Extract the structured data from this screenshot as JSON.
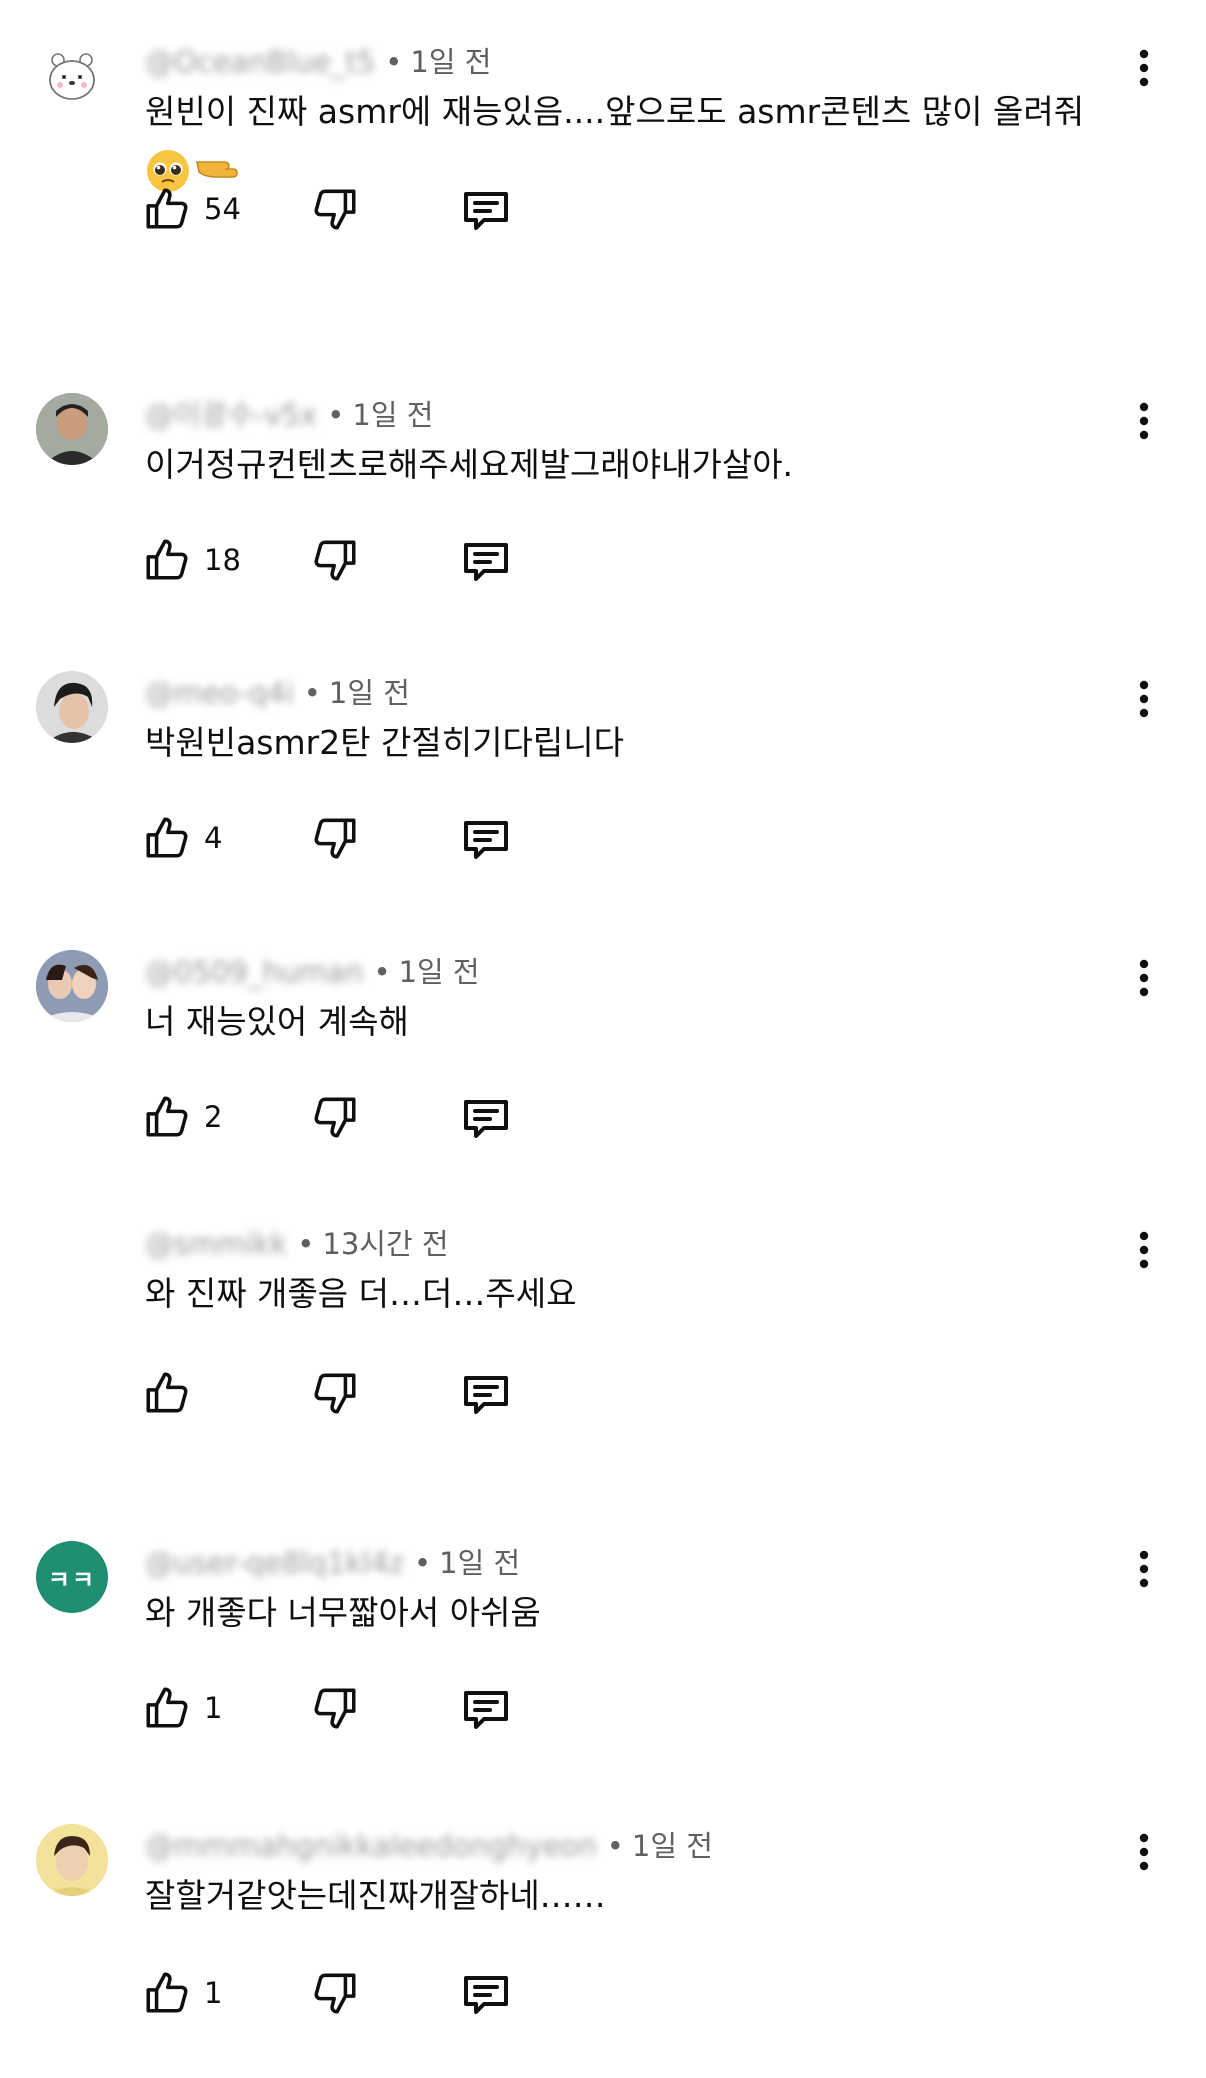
{
  "comments": [
    {
      "handle": "@OceanBlue_t5",
      "time": "1일 전",
      "text": "원빈이 진짜 asmr에 재능있음....앞으로도 asmr콘텐츠 많이 올려줘",
      "emoji": "🥺 👉",
      "likes": "54",
      "avatar": "bear-avatar"
    },
    {
      "handle": "@이광수-v5x",
      "time": "1일 전",
      "text": "이거정규컨텐츠로해주세요제발그래야내가살아.",
      "likes": "18",
      "avatar": "photo-avatar"
    },
    {
      "handle": "@meo-q4i",
      "time": "1일 전",
      "text": "박원빈asmr2탄 간절히기다립니다",
      "likes": "4",
      "avatar": "photo-avatar"
    },
    {
      "handle": "@0509_human",
      "time": "1일 전",
      "text": "너 재능있어 계속해",
      "likes": "2",
      "avatar": "photo-avatar"
    },
    {
      "handle": "@smmikk",
      "time": "13시간 전",
      "text": "와 진짜 개좋음 더…더…주세요",
      "likes": "",
      "avatar": "none"
    },
    {
      "handle": "@user-qe8lq1kl4z",
      "time": "1일 전",
      "text": "와 개좋다 너무짧아서 아쉬움",
      "likes": "1",
      "avatar": "letter-avatar",
      "avatar_text": "ㅋㅋ",
      "avatar_color": "#1e8f72"
    },
    {
      "handle": "@mmmahgnikkaleedonghyeon",
      "time": "1일 전",
      "text": "잘할거같앗는데진짜개잘하네……",
      "likes": "1",
      "avatar": "photo-avatar"
    }
  ],
  "ui": {
    "dot": "•",
    "icons": {
      "like": "thumb-up-icon",
      "dislike": "thumb-down-icon",
      "reply": "reply-icon",
      "more": "more-vert-icon"
    },
    "colors": {
      "text": "#0f0f0f",
      "secondary": "#606060",
      "background": "#ffffff"
    }
  }
}
